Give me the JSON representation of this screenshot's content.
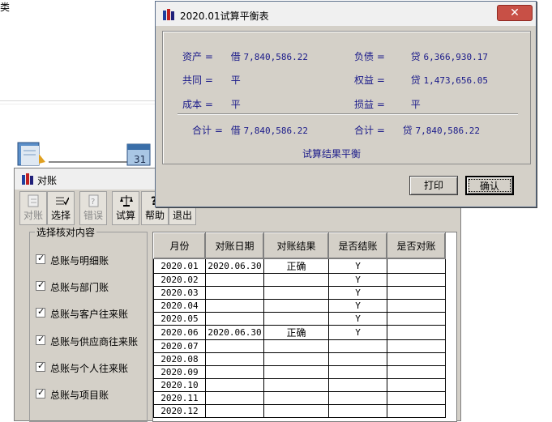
{
  "background": {
    "title_fragment": "类"
  },
  "dialog": {
    "title": "2020.01试算平衡表",
    "close_symbol": "✕",
    "rows": [
      {
        "label": "资产 =",
        "dir": "借",
        "amount": "7,840,586.22"
      },
      {
        "label": "负债 =",
        "dir": "贷",
        "amount": "6,366,930.17"
      },
      {
        "label": "共同 =",
        "dir": "平",
        "amount": ""
      },
      {
        "label": "权益 =",
        "dir": "贷",
        "amount": "1,473,656.05"
      },
      {
        "label": "成本 =",
        "dir": "平",
        "amount": ""
      },
      {
        "label": "损益 =",
        "dir": "平",
        "amount": ""
      }
    ],
    "total_left": {
      "label": "合计 =",
      "dir": "借",
      "amount": "7,840,586.22"
    },
    "total_right": {
      "label": "合计 =",
      "dir": "贷",
      "amount": "7,840,586.22"
    },
    "result": "试算结果平衡",
    "print_label": "打印",
    "confirm_label": "确认"
  },
  "reconcile": {
    "title": "对账",
    "toolbar": [
      {
        "label": "对账",
        "enabled": false,
        "icon": "reconcile-icon"
      },
      {
        "label": "选择",
        "enabled": true,
        "icon": "select-icon"
      },
      {
        "label": "错误",
        "enabled": false,
        "icon": "error-icon"
      },
      {
        "label": "试算",
        "enabled": true,
        "icon": "scale-icon"
      },
      {
        "label": "帮助",
        "enabled": true,
        "icon": "help-icon"
      },
      {
        "label": "退出",
        "enabled": true,
        "icon": "exit-icon"
      }
    ],
    "group_label": "选择核对内容",
    "checks": [
      {
        "label": "总账与明细账",
        "checked": true
      },
      {
        "label": "总账与部门账",
        "checked": true
      },
      {
        "label": "总账与客户往来账",
        "checked": true
      },
      {
        "label": "总账与供应商往来账",
        "checked": true
      },
      {
        "label": "总账与个人往来账",
        "checked": true
      },
      {
        "label": "总账与项目账",
        "checked": true
      }
    ],
    "table": {
      "headers": [
        "月份",
        "对账日期",
        "对账结果",
        "是否结账",
        "是否对账"
      ],
      "rows": [
        [
          "2020.01",
          "2020.06.30",
          "正确",
          "Y",
          ""
        ],
        [
          "2020.02",
          "",
          "",
          "Y",
          ""
        ],
        [
          "2020.03",
          "",
          "",
          "Y",
          ""
        ],
        [
          "2020.04",
          "",
          "",
          "Y",
          ""
        ],
        [
          "2020.05",
          "",
          "",
          "Y",
          ""
        ],
        [
          "2020.06",
          "2020.06.30",
          "正确",
          "Y",
          ""
        ],
        [
          "2020.07",
          "",
          "",
          "",
          ""
        ],
        [
          "2020.08",
          "",
          "",
          "",
          ""
        ],
        [
          "2020.09",
          "",
          "",
          "",
          ""
        ],
        [
          "2020.10",
          "",
          "",
          "",
          ""
        ],
        [
          "2020.11",
          "",
          "",
          "",
          ""
        ],
        [
          "2020.12",
          "",
          "",
          "",
          ""
        ]
      ]
    }
  }
}
